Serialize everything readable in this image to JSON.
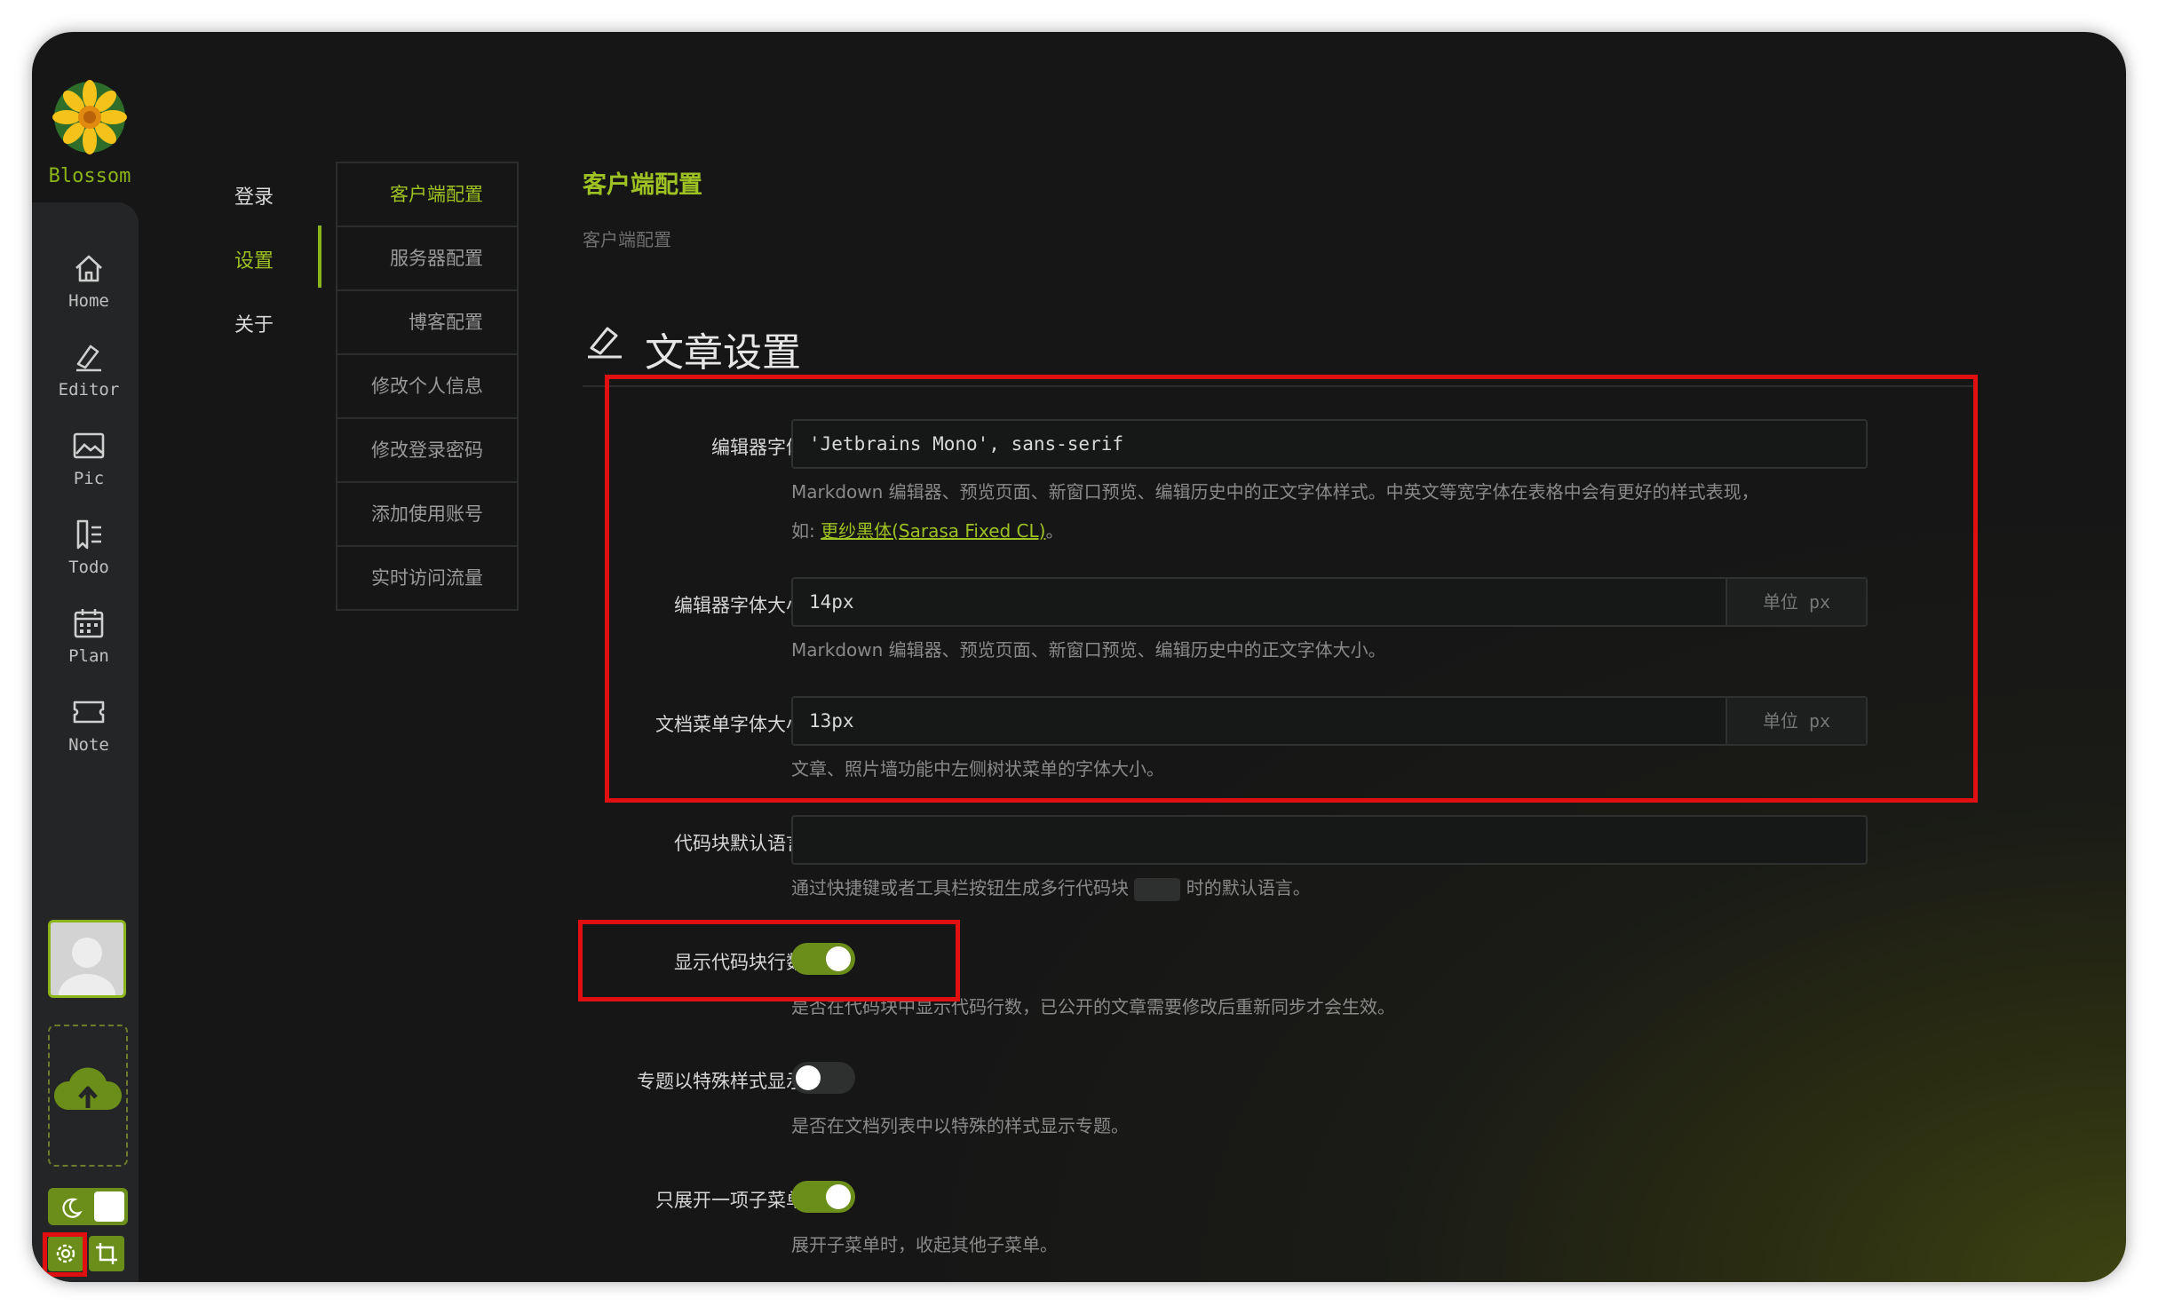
{
  "app": {
    "name": "Blossom"
  },
  "rail": {
    "items": [
      {
        "label": "Home"
      },
      {
        "label": "Editor"
      },
      {
        "label": "Pic"
      },
      {
        "label": "Todo"
      },
      {
        "label": "Plan"
      },
      {
        "label": "Note"
      }
    ]
  },
  "nav": {
    "items": [
      {
        "label": "登录"
      },
      {
        "label": "设置"
      },
      {
        "label": "关于"
      }
    ],
    "active": "设置"
  },
  "subnav": {
    "items": [
      {
        "label": "客户端配置"
      },
      {
        "label": "服务器配置"
      },
      {
        "label": "博客配置"
      },
      {
        "label": "修改个人信息"
      },
      {
        "label": "修改登录密码"
      },
      {
        "label": "添加使用账号"
      },
      {
        "label": "实时访问流量"
      }
    ],
    "active": "客户端配置"
  },
  "page": {
    "title": "客户端配置",
    "subtitle": "客户端配置"
  },
  "section": {
    "title": "文章设置"
  },
  "fields": {
    "editor_font": {
      "label": "编辑器字体",
      "value": "'Jetbrains Mono', sans-serif",
      "help1": "Markdown 编辑器、预览页面、新窗口预览、编辑历史中的正文字体样式。中英文等宽字体在表格中会有更好的样式表现，",
      "help2_prefix": "如: ",
      "help2_link": "更纱黑体(Sarasa Fixed CL)",
      "help2_suffix": "。"
    },
    "editor_font_size": {
      "label": "编辑器字体大小",
      "value": "14px",
      "unit": "单位 px",
      "help": "Markdown 编辑器、预览页面、新窗口预览、编辑历史中的正文字体大小。"
    },
    "menu_font_size": {
      "label": "文档菜单字体大小",
      "value": "13px",
      "unit": "单位 px",
      "help": "文章、照片墙功能中左侧树状菜单的字体大小。"
    },
    "code_lang": {
      "label": "代码块默认语言",
      "value": "",
      "help_prefix": "通过快捷键或者工具栏按钮生成多行代码块",
      "help_suffix": "时的默认语言。"
    },
    "show_line_numbers": {
      "label": "显示代码块行数",
      "on": true,
      "help": "是否在代码块中显示代码行数，已公开的文章需要修改后重新同步才会生效。"
    },
    "special_topic": {
      "label": "专题以特殊样式显示",
      "on": false,
      "help": "是否在文档列表中以特殊的样式显示专题。"
    },
    "single_submenu": {
      "label": "只展开一项子菜单",
      "on": true,
      "help": "展开子菜单时，收起其他子菜单。"
    }
  },
  "colors": {
    "accent": "#8bb31a",
    "highlight": "#e01010"
  }
}
